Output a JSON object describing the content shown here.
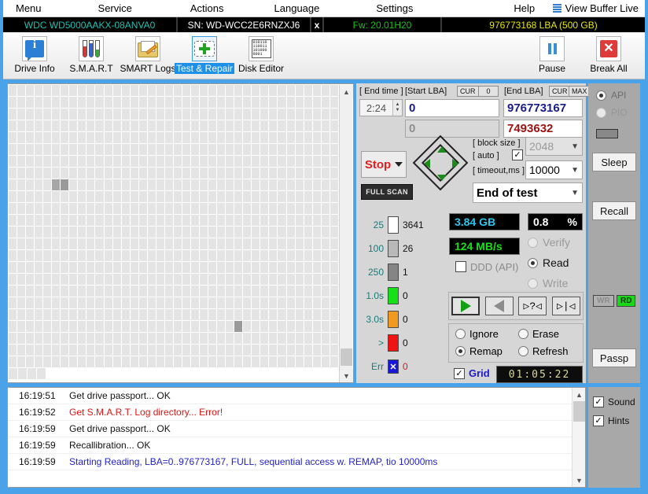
{
  "menu": {
    "items": [
      "Menu",
      "Service",
      "Actions",
      "Language",
      "Settings",
      "Help"
    ],
    "view_buffer": "View Buffer Live",
    "buffer_icon": "list-icon"
  },
  "drive_bar": {
    "model": "WDC WD5000AAKX-08ANVA0",
    "serial": "SN: WD-WCC2E6RNZXJ6",
    "close": "x",
    "firmware": "Fw: 20.01H20",
    "capacity": "976773168 LBA (500 GB)",
    "colors": {
      "model": "#17c4b4",
      "serial": "#ffffff",
      "firmware": "#19c219",
      "capacity": "#e8e800"
    }
  },
  "toolbar": {
    "buttons": [
      {
        "label": "Drive Info",
        "icon": "info-icon",
        "selected": false
      },
      {
        "label": "S.M.A.R.T",
        "icon": "test-tubes-icon",
        "selected": false
      },
      {
        "label": "SMART Logs",
        "icon": "folder-pencil-icon",
        "selected": false
      },
      {
        "label": "Test & Repair",
        "icon": "first-aid-cross-icon",
        "selected": true
      },
      {
        "label": "Disk Editor",
        "icon": "binary-page-icon",
        "selected": false
      }
    ],
    "pause": {
      "label": "Pause",
      "icon": "pause-icon"
    },
    "break_all": {
      "label": "Break All",
      "icon": "red-x-icon"
    }
  },
  "scan": {
    "end_time_label": "[ End time ]",
    "end_time_value": "2:24",
    "start_lba_label": "[Start LBA]",
    "start_lba_cur": "CUR",
    "start_lba_zero": "0",
    "start_lba_value": "0",
    "start_lba_second": "0",
    "end_lba_label": "[End LBA]",
    "end_lba_cur": "CUR",
    "end_lba_max": "MAX",
    "end_lba_value": "976773167",
    "current_lba_value": "7493632",
    "stop_label": "Stop",
    "full_scan_label": "FULL SCAN",
    "block_size_label": "[ block size ]",
    "block_size_value": "2048",
    "auto_label": "[ auto ]",
    "auto_checked": true,
    "timeout_label": "[ timeout,ms ]",
    "timeout_value": "10000",
    "end_of_test_value": "End of test"
  },
  "legend": {
    "rows": [
      {
        "threshold": "25",
        "color": "#ffffff",
        "count": "3641"
      },
      {
        "threshold": "100",
        "color": "#b9b9b9",
        "count": "26"
      },
      {
        "threshold": "250",
        "color": "#858585",
        "count": "1"
      },
      {
        "threshold": "1.0s",
        "color": "#16e016",
        "count": "0"
      },
      {
        "threshold": "3.0s",
        "color": "#f09a22",
        "count": "0"
      },
      {
        "threshold": ">",
        "color": "#ee1414",
        "count": "0"
      },
      {
        "threshold": "Err",
        "color": "#1818d8",
        "count": "0",
        "err": true
      }
    ]
  },
  "stats": {
    "processed": "3.84 GB",
    "percent": "0.8",
    "percent_unit": "%",
    "speed": "124 MB/s",
    "ddd_label": "DDD (API)",
    "ddd_checked": false,
    "modes": [
      {
        "label": "Verify",
        "selected": false,
        "disabled": true
      },
      {
        "label": "Read",
        "selected": true,
        "disabled": false
      },
      {
        "label": "Write",
        "selected": false,
        "disabled": true
      }
    ]
  },
  "transport": {
    "buttons": [
      "play-icon",
      "rewind-icon",
      "seek-question-icon",
      "skip-end-icon"
    ]
  },
  "actions": {
    "options": [
      {
        "label": "Ignore",
        "selected": false
      },
      {
        "label": "Erase",
        "selected": false
      },
      {
        "label": "Remap",
        "selected": true
      },
      {
        "label": "Refresh",
        "selected": false
      }
    ]
  },
  "footer": {
    "grid_label": "Grid",
    "grid_checked": true,
    "timer": "01:05:22"
  },
  "sidebar": {
    "api": {
      "label": "API",
      "selected": true
    },
    "pio": {
      "label": "PIO",
      "selected": false
    },
    "sleep": "Sleep",
    "recall": "Recall",
    "wr_tag": "WR",
    "rd_tag": "RD",
    "passp": "Passp"
  },
  "log": {
    "rows": [
      {
        "time": "16:19:51",
        "message": "Get drive passport... OK",
        "color": "#111111"
      },
      {
        "time": "16:19:52",
        "message": "Get S.M.A.R.T. Log directory... Error!",
        "color": "#e01414"
      },
      {
        "time": "16:19:59",
        "message": "Get drive passport... OK",
        "color": "#111111"
      },
      {
        "time": "16:19:59",
        "message": "Recallibration... OK",
        "color": "#111111"
      },
      {
        "time": "16:19:59",
        "message": "Starting Reading, LBA=0..976773167, FULL, sequential access w. REMAP, tio 10000ms",
        "color": "#2222cc"
      }
    ]
  },
  "options": {
    "sound": {
      "label": "Sound",
      "checked": true
    },
    "hints": {
      "label": "Hints",
      "checked": true
    }
  },
  "grid_map": {
    "rows": 25,
    "cols": 38,
    "filled_rows": 24,
    "last_row_cells": 4,
    "marks": [
      {
        "row": 8,
        "col": 5,
        "shade": "c-grey"
      },
      {
        "row": 8,
        "col": 6,
        "shade": "c-dgrey"
      },
      {
        "row": 20,
        "col": 26,
        "shade": "c-dgrey"
      }
    ]
  }
}
